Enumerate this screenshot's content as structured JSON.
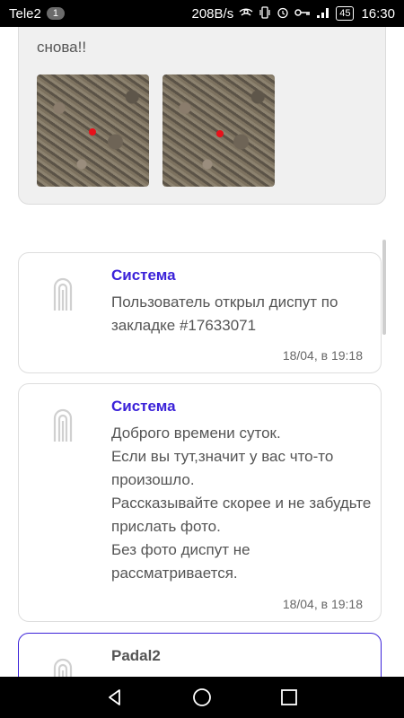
{
  "status_bar": {
    "carrier": "Tele2",
    "carrier_badge": "1",
    "speed": "208B/s",
    "battery": "45",
    "time": "16:30",
    "icons": [
      "wifi-hotspot-icon",
      "vibrate-icon",
      "alarm-icon",
      "key-icon",
      "signal-icon"
    ]
  },
  "previous_message": {
    "text_tail": "снова!!",
    "photos": [
      "photo-1",
      "photo-2"
    ]
  },
  "messages": [
    {
      "author": "Система",
      "lines": [
        "Пользователь открыл диспут по закладке #17633071"
      ],
      "time": "18/04, в 19:18"
    },
    {
      "author": "Система",
      "lines": [
        "Доброго времени суток.",
        "Если вы тут,значит у вас что-то произошло.",
        "Рассказывайте скорее и не забудьте прислать фото.",
        "Без фото диспут не рассматривается."
      ],
      "time": "18/04, в 19:18"
    },
    {
      "author": "Padal2"
    }
  ],
  "colors": {
    "accent": "#3b22d9",
    "card_border": "#dddddd",
    "prev_card_bg": "#f0f0f0",
    "marker": "#e8101a"
  }
}
